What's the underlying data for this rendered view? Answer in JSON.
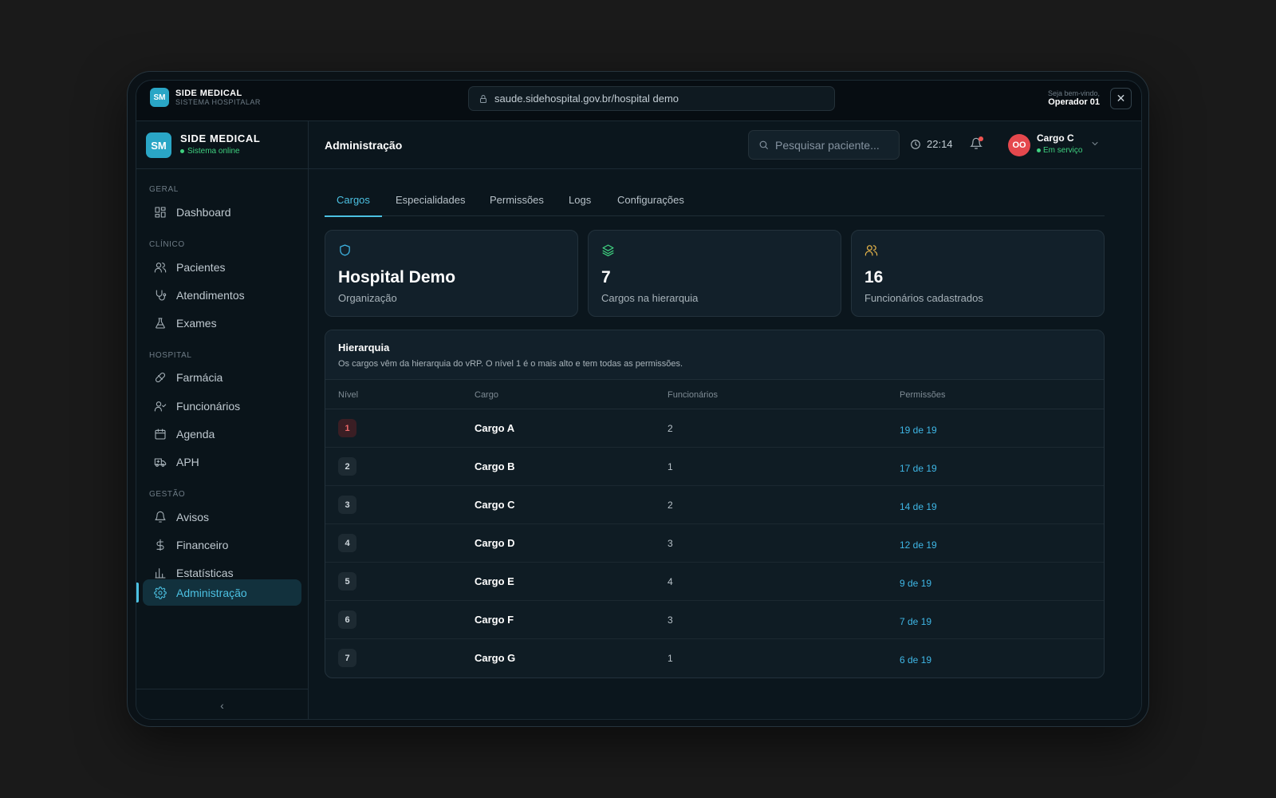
{
  "browser": {
    "logo": "SM",
    "brand": "SIDE MEDICAL",
    "brand_sub": "SISTEMA HOSPITALAR",
    "url": "saude.sidehospital.gov.br/hospital demo",
    "welcome": "Seja bem-vindo,",
    "operator": "Operador 01",
    "close_glyph": "✕"
  },
  "sidebar": {
    "logo": "SM",
    "title": "SIDE MEDICAL",
    "status": "Sistema online",
    "collapse_glyph": "‹",
    "sections": {
      "geral": "GERAL",
      "clinico": "CLÍNICO",
      "hospital": "HOSPITAL",
      "gestao": "GESTÃO"
    },
    "items": [
      {
        "label": "Dashboard",
        "icon": "grid-icon"
      },
      {
        "label": "Pacientes",
        "icon": "users-icon"
      },
      {
        "label": "Atendimentos",
        "icon": "stethoscope-icon"
      },
      {
        "label": "Exames",
        "icon": "flask-icon"
      },
      {
        "label": "Farmácia",
        "icon": "pill-icon"
      },
      {
        "label": "Funcionários",
        "icon": "user-check-icon"
      },
      {
        "label": "Agenda",
        "icon": "calendar-icon"
      },
      {
        "label": "APH",
        "icon": "ambulance-icon"
      },
      {
        "label": "Avisos",
        "icon": "bell-icon"
      },
      {
        "label": "Financeiro",
        "icon": "dollar-icon"
      },
      {
        "label": "Estatísticas",
        "icon": "bar-chart-icon"
      },
      {
        "label": "Administração",
        "icon": "gear-icon",
        "active": true
      }
    ]
  },
  "header": {
    "title": "Administração",
    "search_placeholder": "Pesquisar paciente...",
    "time": "22:14",
    "user_initials": "OO",
    "user_name": "Cargo C",
    "user_status": "Em serviço"
  },
  "tabs": [
    "Cargos",
    "Especialidades",
    "Permissões",
    "Logs",
    "Configurações"
  ],
  "active_tab": "Cargos",
  "cards": [
    {
      "value": "Hospital Demo",
      "label": "Organização",
      "icon": "shield-icon",
      "color": "#3fb7e6"
    },
    {
      "value": "7",
      "label": "Cargos na hierarquia",
      "icon": "layers-icon",
      "color": "#3fd07f"
    },
    {
      "value": "16",
      "label": "Funcionários cadastrados",
      "icon": "users-icon",
      "color": "#e8b54a"
    }
  ],
  "hierarchy": {
    "title": "Hierarquia",
    "subtitle": "Os cargos vêm da hierarquia do vRP. O nível 1 é o mais alto e tem todas as permissões.",
    "columns": [
      "Nível",
      "Cargo",
      "Funcionários",
      "Permissões"
    ],
    "rows": [
      {
        "level": "1",
        "cargo": "Cargo A",
        "func": "2",
        "perm": "19 de 19"
      },
      {
        "level": "2",
        "cargo": "Cargo B",
        "func": "1",
        "perm": "17 de 19"
      },
      {
        "level": "3",
        "cargo": "Cargo C",
        "func": "2",
        "perm": "14 de 19"
      },
      {
        "level": "4",
        "cargo": "Cargo D",
        "func": "3",
        "perm": "12 de 19"
      },
      {
        "level": "5",
        "cargo": "Cargo E",
        "func": "4",
        "perm": "9 de 19"
      },
      {
        "level": "6",
        "cargo": "Cargo F",
        "func": "3",
        "perm": "7 de 19"
      },
      {
        "level": "7",
        "cargo": "Cargo G",
        "func": "1",
        "perm": "6 de 19"
      }
    ]
  }
}
